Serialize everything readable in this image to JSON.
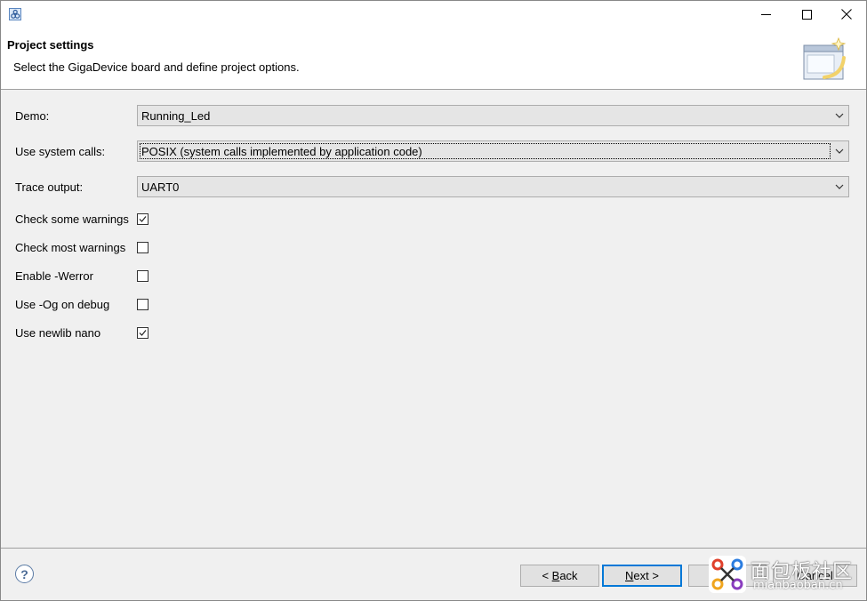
{
  "window": {
    "app_icon": "gigadevice-app-icon",
    "controls": {
      "minimize": "minimize-icon",
      "maximize": "maximize-icon",
      "close": "close-icon"
    }
  },
  "header": {
    "title": "Project settings",
    "description": "Select the GigaDevice board and define project options.",
    "image": "wizard-banner-icon"
  },
  "fields": {
    "demo": {
      "label": "Demo:",
      "value": "Running_Led"
    },
    "system_calls": {
      "label": "Use system calls:",
      "value": "POSIX (system calls implemented by application code)"
    },
    "trace_output": {
      "label": "Trace output:",
      "value": "UART0"
    }
  },
  "options": [
    {
      "label": "Check some warnings",
      "checked": true
    },
    {
      "label": "Check most warnings",
      "checked": false
    },
    {
      "label": "Enable -Werror",
      "checked": false
    },
    {
      "label": "Use -Og on debug",
      "checked": false
    },
    {
      "label": "Use newlib nano",
      "checked": true
    }
  ],
  "footer": {
    "help": "?",
    "back_mnemonic": "B",
    "back_rest": "ack",
    "back_prefix": "< ",
    "next_mnemonic": "N",
    "next_rest": "ext >",
    "cancel": "Cancel"
  },
  "watermark": {
    "text": "面包板社区",
    "url": "mianbaoban.cn"
  },
  "colors": {
    "focus_border": "#0078d7",
    "header_bg": "#ffffff",
    "dialog_bg": "#f0f0f0"
  }
}
